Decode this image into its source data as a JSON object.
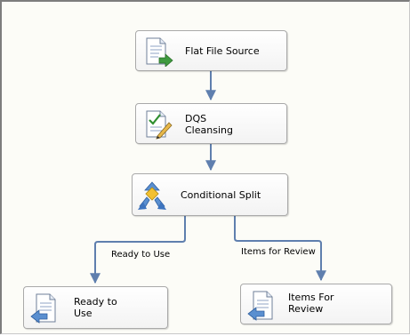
{
  "nodes": {
    "flat_file_source": {
      "label": "Flat File Source",
      "icon": "flat-file-source-icon"
    },
    "dqs_cleansing": {
      "label": "DQS\nCleansing",
      "icon": "dqs-cleansing-icon"
    },
    "conditional_split": {
      "label": "Conditional Split",
      "icon": "conditional-split-icon"
    },
    "ready_to_use": {
      "label": "Ready to\nUse",
      "icon": "destination-icon"
    },
    "items_for_review": {
      "label": "Items For\nReview",
      "icon": "destination-icon"
    }
  },
  "paths": {
    "ready_to_use": "Ready to Use",
    "items_for_review": "Items for Review"
  },
  "colors": {
    "connector": "#5f7fae",
    "canvas": "#fcfcf7",
    "node_border": "#a9a9a9"
  }
}
